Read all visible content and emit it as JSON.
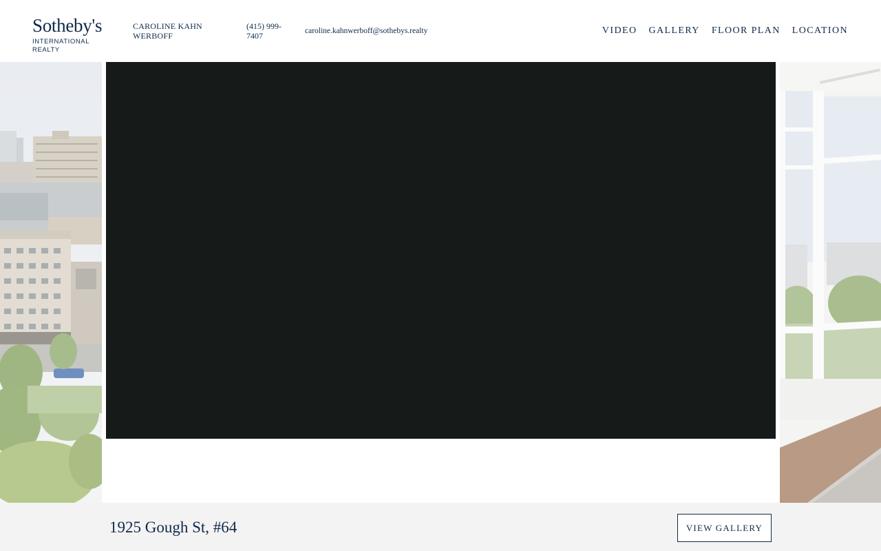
{
  "brand": {
    "name": "Sotheby's",
    "subtitle": "INTERNATIONAL REALTY",
    "color": "#0f2a4a"
  },
  "agent": {
    "name": "CAROLINE KAHN WERBOFF",
    "phone": "(415) 999-7407",
    "email": "caroline.kahnwerboff@sothebys.realty"
  },
  "nav": {
    "items": [
      {
        "label": "VIDEO"
      },
      {
        "label": "GALLERY"
      },
      {
        "label": "FLOOR PLAN"
      },
      {
        "label": "LOCATION"
      }
    ]
  },
  "video": {
    "background": "#161a18"
  },
  "footer": {
    "address": "1925 Gough St, #64",
    "button_label": "VIEW GALLERY"
  }
}
